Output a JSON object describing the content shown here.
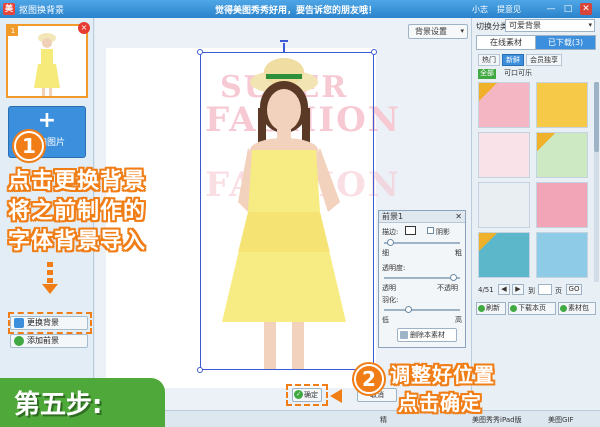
{
  "titlebar": {
    "app_title": "抠图换背景",
    "promo": "觉得美图秀秀好用，要告诉您的朋友哦！",
    "user": "小志",
    "feedback": "提意见",
    "minimize": "—",
    "maximize": "□",
    "close": "✕"
  },
  "left": {
    "thumb_number": "1",
    "add_image_label": "添加图片",
    "add_plus": "+",
    "change_bg_label": "更换背景",
    "add_fg_label": "添加前景"
  },
  "annotations": {
    "step1_number": "1",
    "step1_line1": "点击更换背景",
    "step1_line2": "将之前制作的",
    "step1_line3": "字体背景导入",
    "step2_number": "2",
    "step2_line1": "调整好位置",
    "step2_line2": "点击确定",
    "step_banner": "第五步:"
  },
  "workspace": {
    "bg_settings_label": "背景设置",
    "bg_text_line1": "SUPER",
    "bg_text_line2": "FASHION",
    "bg_text_line3": "FASHION",
    "confirm_label": "确定",
    "other_label": "取消"
  },
  "fg_panel": {
    "title": "前景1",
    "close": "✕",
    "border_label": "描边:",
    "shadow_label": "阴影",
    "thin": "细",
    "thick": "粗",
    "transparency_label": "透明度:",
    "transparent": "透明",
    "opaque": "不透明",
    "feather_label": "羽化:",
    "low": "低",
    "high": "高",
    "delete_label": "删除本素材",
    "border_value": 0.05,
    "transparency_value": 0.95,
    "feather_value": 0.3
  },
  "right": {
    "category_label": "切换分类",
    "category_value": "可爱背景",
    "tabs": [
      "在线素材",
      "已下载(3)"
    ],
    "subtabs": [
      "热门",
      "新鲜",
      "会员独享"
    ],
    "filters": [
      "全部",
      "可口可乐"
    ],
    "ribbon_text": "会员",
    "pager_text": "4/51",
    "pager_goto": "到",
    "pager_page": "页",
    "pager_go": "GO",
    "prev": "◀",
    "next": "▶",
    "refresh_label": "刷新",
    "download_page_label": "下载本页",
    "material_pack_label": "素材包",
    "thumb_colors": [
      "#f4b6c2",
      "#f7c948",
      "#f9e3e8",
      "#cde9c3",
      "#e9eef2",
      "#f2a5b7",
      "#5bb7c9",
      "#8ecbe6"
    ]
  },
  "statusbar": {
    "left_text": "精",
    "center_text": "美图秀秀iPad版",
    "right_text": "美图GIF"
  },
  "colors": {
    "accent": "#3b8fdc",
    "annotation": "#f07d15",
    "step_green": "#4fa83a"
  }
}
